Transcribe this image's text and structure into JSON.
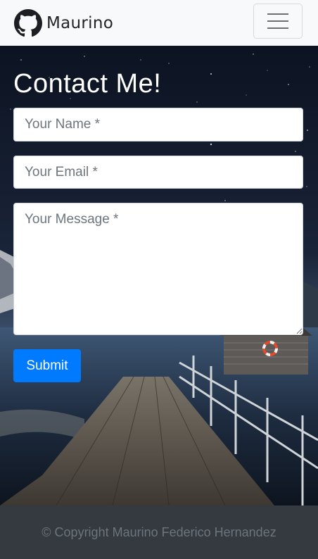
{
  "navbar": {
    "brand": "Maurino",
    "logo_icon": "github-icon",
    "toggler_icon": "hamburger-menu-icon"
  },
  "contact": {
    "title": "Contact Me!",
    "name_placeholder": "Your Name *",
    "email_placeholder": "Your Email *",
    "message_placeholder": "Your Message *",
    "submit_label": "Submit"
  },
  "footer": {
    "copyright": "© Copyright Maurino Federico Hernandez"
  },
  "colors": {
    "primary": "#007bff",
    "navbar_bg": "#f8f9fa",
    "footer_bg": "#343a40"
  }
}
